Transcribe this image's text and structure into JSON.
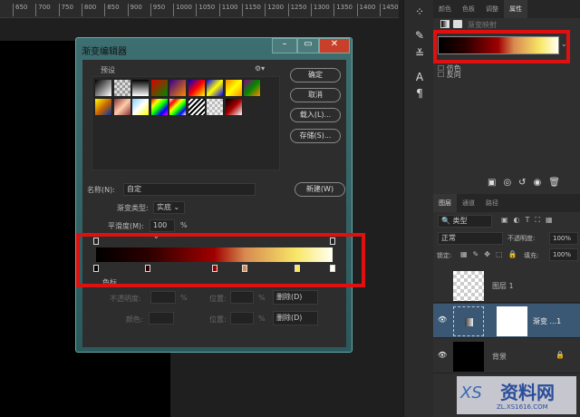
{
  "ruler": {
    "ticks": [
      "650",
      "700",
      "750",
      "800",
      "850",
      "900",
      "950",
      "1000",
      "1050",
      "1100",
      "1150",
      "1200",
      "1250",
      "1300",
      "1350",
      "1400",
      "1450"
    ]
  },
  "dialog": {
    "title": "渐变编辑器",
    "presets_label": "预设",
    "ok": "确定",
    "cancel": "取消",
    "load": "载入(L)...",
    "save": "存储(S)...",
    "name_label": "名称(N):",
    "name_value": "自定",
    "new": "新建(W)",
    "type_label": "渐变类型:",
    "type_value": "实底",
    "smooth_label": "平滑度(M):",
    "smooth_value": "100",
    "pct": "%",
    "stops_label": "色标",
    "opacity_label": "不透明度:",
    "location_label": "位置:",
    "delete_label": "删除(D)",
    "color_label": "颜色:"
  },
  "gradient": {
    "stops": [
      {
        "pos": 0,
        "color": "#000000"
      },
      {
        "pos": 22,
        "color": "#2a0000"
      },
      {
        "pos": 50,
        "color": "#a00000"
      },
      {
        "pos": 63,
        "color": "#d88a50"
      },
      {
        "pos": 85,
        "color": "#f8e868"
      },
      {
        "pos": 100,
        "color": "#fffff2"
      }
    ],
    "opacity_stops": [
      0,
      100
    ]
  },
  "properties": {
    "tabs": [
      "颜色",
      "色板",
      "调整",
      "属性"
    ],
    "active_tab": "属性",
    "title": "渐变映射",
    "dither": "仿色",
    "reverse": "反向"
  },
  "layers": {
    "tabs": [
      "图层",
      "通道",
      "路径"
    ],
    "filter": "类型",
    "blend": "正常",
    "opacity_label": "不透明度:",
    "opacity": "100%",
    "lock_label": "锁定:",
    "fill_label": "填充:",
    "fill": "100%",
    "items": [
      {
        "name": "图层 1",
        "visible": false
      },
      {
        "name": "渐变 ...1",
        "visible": true,
        "selected": true
      },
      {
        "name": "背景",
        "visible": true,
        "locked": true
      }
    ]
  },
  "watermark": {
    "text": "资料网",
    "url": "ZL.XS1616.COM",
    "logo": "XS"
  },
  "highlight_color": "#e01010"
}
